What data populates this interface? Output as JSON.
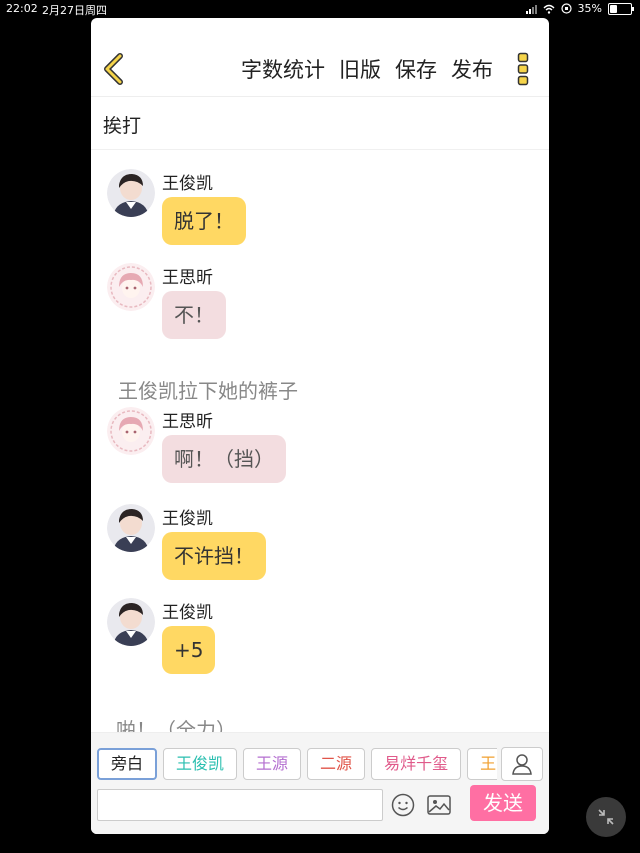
{
  "status_bar": {
    "time": "22:02",
    "date": "2月27日周四",
    "battery": "35%"
  },
  "toolbar": {
    "word_count": "字数统计",
    "old_version": "旧版",
    "save": "保存",
    "publish": "发布"
  },
  "story": {
    "title": "挨打"
  },
  "messages": [
    {
      "type": "dialog",
      "sender": "王俊凯",
      "text": "脱了！",
      "style": "yellow"
    },
    {
      "type": "dialog",
      "sender": "王思昕",
      "text": "不！",
      "style": "pink"
    },
    {
      "type": "narration",
      "text": "王俊凯拉下她的裤子"
    },
    {
      "type": "dialog",
      "sender": "王思昕",
      "text": "啊！（挡）",
      "style": "pink"
    },
    {
      "type": "dialog",
      "sender": "王俊凯",
      "text": "不许挡！",
      "style": "yellow"
    },
    {
      "type": "dialog",
      "sender": "王俊凯",
      "text": "+5",
      "style": "yellow"
    },
    {
      "type": "narration",
      "text": "啪！（全力）"
    }
  ],
  "characters": [
    {
      "label": "旁白",
      "color": "#222222"
    },
    {
      "label": "王俊凯",
      "color": "#2bbfb0"
    },
    {
      "label": "王源",
      "color": "#b46fd0"
    },
    {
      "label": "二源",
      "color": "#e0554a"
    },
    {
      "label": "易烊千玺",
      "color": "#e05a8a"
    },
    {
      "label": "王",
      "color": "#f0a030"
    }
  ],
  "composer": {
    "input_value": "",
    "send_label": "发送"
  },
  "colors": {
    "yellow_bubble": "#ffd863",
    "pink_bubble": "#f3dde0",
    "send": "#ff6fa3",
    "back_arrow": "#d4b43a"
  }
}
